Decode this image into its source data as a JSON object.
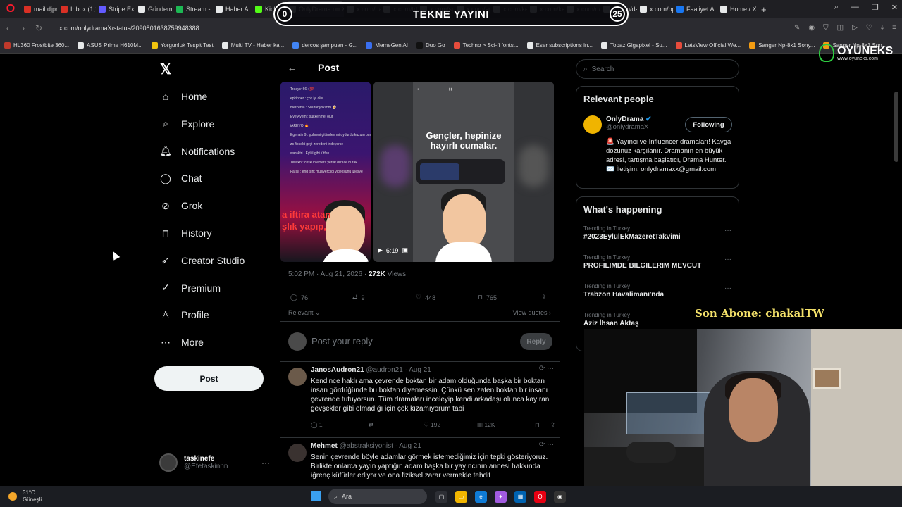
{
  "browser": {
    "tabs": [
      {
        "label": "mail.djpn...",
        "color": "#d93025"
      },
      {
        "label": "Inbox (1,1...",
        "color": "#d93025"
      },
      {
        "label": "Stripe Exp...",
        "color": "#635bff"
      },
      {
        "label": "Gündem |...",
        "color": "#e7e9ea"
      },
      {
        "label": "Stream - ...",
        "color": "#1db954"
      },
      {
        "label": "Haber Al...",
        "color": "#e7e9ea"
      },
      {
        "label": "KickLink",
        "color": "#53fc18"
      },
      {
        "label": "OnlyDrama on X",
        "color": "#e7e9ea"
      },
      {
        "label": "x.com/dar...",
        "color": "#e7e9ea"
      },
      {
        "label": "x.com/trtl...",
        "color": "#e7e9ea"
      },
      {
        "label": "x.com/spo...",
        "color": "#e7e9ea"
      },
      {
        "label": "x.com/sp...",
        "color": "#e7e9ea"
      },
      {
        "label": "x.com/ke...",
        "color": "#e7e9ea"
      },
      {
        "label": "x.com/ke...",
        "color": "#e7e9ea"
      },
      {
        "label": "x.com/da...",
        "color": "#e7e9ea"
      },
      {
        "label": "x.com/da...",
        "color": "#e7e9ea"
      },
      {
        "label": "x.com/bp...",
        "color": "#e7e9ea"
      },
      {
        "label": "Faaliyet A...",
        "color": "#1877f2"
      },
      {
        "label": "Home / X",
        "color": "#e7e9ea"
      }
    ],
    "new_tab_label": "+",
    "url": "x.com/onlydramaX/status/2090801638759948388",
    "bookmarks": [
      {
        "label": "HL360 Frostbite 360...",
        "color": "#c0392b"
      },
      {
        "label": "ASUS Prime H610M...",
        "color": "#e7e9ea"
      },
      {
        "label": "Yorgunluk Tespit Test",
        "color": "#f1c40f"
      },
      {
        "label": "Multi TV - Haber ka...",
        "color": "#e7e9ea"
      },
      {
        "label": "dercos şampuan - G...",
        "color": "#4285f4"
      },
      {
        "label": "MemeGen AI",
        "color": "#3a6ff0"
      },
      {
        "label": "Duo Go",
        "color": "#111"
      },
      {
        "label": "Techno > Sci-fi fonts...",
        "color": "#e74c3c"
      },
      {
        "label": "Eser subscriptions in...",
        "color": "#e7e9ea"
      },
      {
        "label": "Topaz Gigapixel - Su...",
        "color": "#e7e9ea"
      },
      {
        "label": "LetsView Official We...",
        "color": "#e74c3c"
      },
      {
        "label": "Sanger Np-8x1 Sony...",
        "color": "#f39c12"
      },
      {
        "label": "Sanger Np-8x1 Son...",
        "color": "#f39c12"
      }
    ]
  },
  "overlay": {
    "stream_title": "TEKNE YAYINI",
    "count_left": "0",
    "count_right": "25",
    "brand": "OYUNEKS",
    "brand_url": "www.oyuneks.com",
    "last_sub": "Son Abone: chakalTW"
  },
  "sidebar": {
    "items": [
      {
        "label": "Home",
        "icon": "home-icon"
      },
      {
        "label": "Explore",
        "icon": "search-icon"
      },
      {
        "label": "Notifications",
        "icon": "bell-icon"
      },
      {
        "label": "Chat",
        "icon": "chat-icon"
      },
      {
        "label": "Grok",
        "icon": "grok-icon"
      },
      {
        "label": "History",
        "icon": "bookmark-icon"
      },
      {
        "label": "Creator Studio",
        "icon": "rocket-icon"
      },
      {
        "label": "Premium",
        "icon": "verified-icon"
      },
      {
        "label": "Profile",
        "icon": "person-icon"
      },
      {
        "label": "More",
        "icon": "more-icon"
      }
    ],
    "post_button": "Post",
    "account": {
      "name": "taskinefe",
      "handle": "@Efetaskinnn"
    }
  },
  "post": {
    "header_title": "Post",
    "left_media_caption_line1": "a iftira atan",
    "left_media_caption_line2": "şlık yapıp,",
    "chat_lines": [
      "Tracyc466 : 💯",
      "epkinner : çok iyi olur",
      "mercenia : Shurabynkimm 🍺",
      "EvetAyem : sükkenmel olur",
      "iAREYO 🔥",
      "Egehaim9 : şuhreni gittinden mi uydurdu kuzum burada sia",
      "zc fiocekt geyi zeredeni indeyerce",
      "waraktri : Eylül gibi lütfen",
      "Tewrkh : coşkun emerit yeriat diiraite burak",
      "Farali : eng türk mülliyerçliği videosunu izlesye"
    ],
    "video_caption": "Gençler, hepinize hayırlı cumalar.",
    "video_duration": "6:19",
    "timestamp": "5:02 PM · Aug 21, 2026 ·",
    "views": "272K",
    "views_label": "Views",
    "stats": {
      "replies": "76",
      "reposts": "9",
      "likes": "448",
      "bookmarks": "765"
    },
    "sort_label": "Relevant",
    "view_quotes": "View quotes",
    "reply_placeholder": "Post your reply",
    "reply_button": "Reply"
  },
  "replies": [
    {
      "name": "JanosAudron21",
      "handle": "@audron21",
      "date": "· Aug 21",
      "text": "Kendince haklı ama çevrende boktan bir adam olduğunda başka bir boktan insan gördüğünde bu boktan diyemessin. Çünkü sen zaten boktan bir insanı çevrende tutuyorsun. Tüm dramaları inceleyip kendi arkadaşı olunca kayıran gevşekler gibi olmadığı için çok kızamıyorum tabi",
      "replies": "1",
      "reposts": "",
      "likes": "192",
      "views": "12K"
    },
    {
      "name": "Mehmet",
      "handle": "@abstraksiyonist",
      "date": "· Aug 21",
      "text": "Senin çevrende böyle adamlar görmek istemediğimiz için tepki gösteriyoruz. Birlikte onlarca yayın yaptığın adam başka bir yayıncının annesi hakkında iğrenç küfürler ediyor ve ona fiziksel zarar vermekle tehdit",
      "replies": "",
      "reposts": "",
      "likes": "",
      "views": ""
    }
  ],
  "right": {
    "search_placeholder": "Search",
    "relevant_title": "Relevant people",
    "person": {
      "name": "OnlyDrama",
      "handle": "@onlydramaX",
      "follow_label": "Following",
      "bio": "🚨 Yayıncı ve Influencer dramaları! Kavga dozunuz karşılanır. Dramanın en büyük adresi, tartışma başlatıcı, Drama Hunter. ✉️ İletişim: onlydramaxx@gmail.com"
    },
    "happening_title": "What's happening",
    "trends": [
      {
        "context": "Trending in Turkey",
        "name": "#2023EylülEkMazeretTakvimi"
      },
      {
        "context": "Trending in Turkey",
        "name": "PROFILIMDE BILGILERIM MEVCUT"
      },
      {
        "context": "Trending in Turkey",
        "name": "Trabzon Havalimanı'nda"
      },
      {
        "context": "Trending in Turkey",
        "name": "Aziz İhsan Aktaş"
      }
    ]
  },
  "taskbar": {
    "temp": "31°C",
    "weather": "Güneşli",
    "search_label": "Ara"
  },
  "colors": {
    "accent": "#1d9bf0",
    "like_pink": "#f91880",
    "background": "#000000"
  }
}
